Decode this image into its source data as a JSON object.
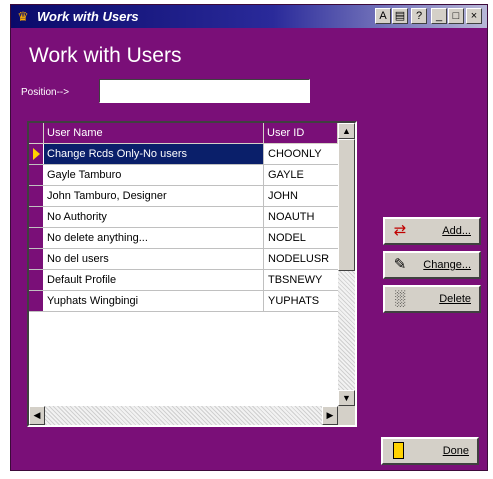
{
  "window": {
    "title": "Work with Users",
    "title_buttons": [
      "A",
      "▤",
      "?",
      "_",
      "□",
      "×"
    ]
  },
  "heading": "Work with Users",
  "position": {
    "label": "Position-->",
    "value": ""
  },
  "list": {
    "columns": [
      "User Name",
      "User ID"
    ],
    "rows": [
      {
        "name": "Change Rcds Only-No users",
        "id": "CHOONLY",
        "selected": true
      },
      {
        "name": "Gayle Tamburo",
        "id": "GAYLE",
        "selected": false
      },
      {
        "name": "John Tamburo, Designer",
        "id": "JOHN",
        "selected": false
      },
      {
        "name": "No Authority",
        "id": "NOAUTH",
        "selected": false
      },
      {
        "name": "No delete anything...",
        "id": "NODEL",
        "selected": false
      },
      {
        "name": "No del users",
        "id": "NODELUSR",
        "selected": false
      },
      {
        "name": "Default Profile",
        "id": "TBSNEWY",
        "selected": false
      },
      {
        "name": "Yuphats Wingbingi",
        "id": "YUPHATS",
        "selected": false
      }
    ]
  },
  "buttons": {
    "add": "Add...",
    "change": "Change...",
    "delete": "Delete",
    "done": "Done"
  },
  "colors": {
    "window_bg": "#7a0f78",
    "selection": "#0a1f6a",
    "titlebar": "#0a0a6a"
  }
}
